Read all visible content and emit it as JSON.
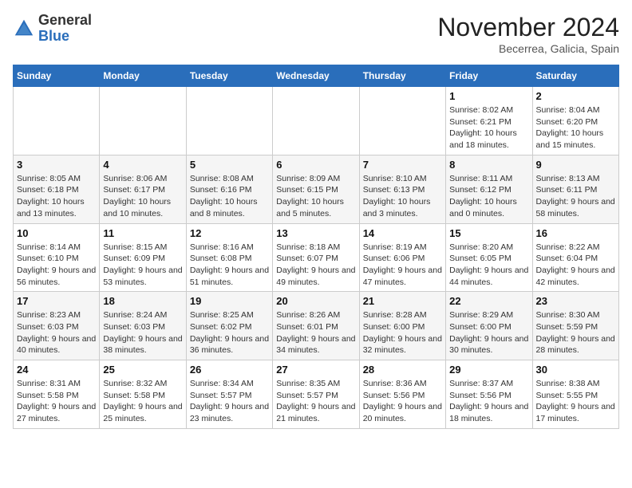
{
  "header": {
    "logo_line1": "General",
    "logo_line2": "Blue",
    "month": "November 2024",
    "location": "Becerrea, Galicia, Spain"
  },
  "weekdays": [
    "Sunday",
    "Monday",
    "Tuesday",
    "Wednesday",
    "Thursday",
    "Friday",
    "Saturday"
  ],
  "weeks": [
    [
      {
        "day": "",
        "info": ""
      },
      {
        "day": "",
        "info": ""
      },
      {
        "day": "",
        "info": ""
      },
      {
        "day": "",
        "info": ""
      },
      {
        "day": "",
        "info": ""
      },
      {
        "day": "1",
        "info": "Sunrise: 8:02 AM\nSunset: 6:21 PM\nDaylight: 10 hours and 18 minutes."
      },
      {
        "day": "2",
        "info": "Sunrise: 8:04 AM\nSunset: 6:20 PM\nDaylight: 10 hours and 15 minutes."
      }
    ],
    [
      {
        "day": "3",
        "info": "Sunrise: 8:05 AM\nSunset: 6:18 PM\nDaylight: 10 hours and 13 minutes."
      },
      {
        "day": "4",
        "info": "Sunrise: 8:06 AM\nSunset: 6:17 PM\nDaylight: 10 hours and 10 minutes."
      },
      {
        "day": "5",
        "info": "Sunrise: 8:08 AM\nSunset: 6:16 PM\nDaylight: 10 hours and 8 minutes."
      },
      {
        "day": "6",
        "info": "Sunrise: 8:09 AM\nSunset: 6:15 PM\nDaylight: 10 hours and 5 minutes."
      },
      {
        "day": "7",
        "info": "Sunrise: 8:10 AM\nSunset: 6:13 PM\nDaylight: 10 hours and 3 minutes."
      },
      {
        "day": "8",
        "info": "Sunrise: 8:11 AM\nSunset: 6:12 PM\nDaylight: 10 hours and 0 minutes."
      },
      {
        "day": "9",
        "info": "Sunrise: 8:13 AM\nSunset: 6:11 PM\nDaylight: 9 hours and 58 minutes."
      }
    ],
    [
      {
        "day": "10",
        "info": "Sunrise: 8:14 AM\nSunset: 6:10 PM\nDaylight: 9 hours and 56 minutes."
      },
      {
        "day": "11",
        "info": "Sunrise: 8:15 AM\nSunset: 6:09 PM\nDaylight: 9 hours and 53 minutes."
      },
      {
        "day": "12",
        "info": "Sunrise: 8:16 AM\nSunset: 6:08 PM\nDaylight: 9 hours and 51 minutes."
      },
      {
        "day": "13",
        "info": "Sunrise: 8:18 AM\nSunset: 6:07 PM\nDaylight: 9 hours and 49 minutes."
      },
      {
        "day": "14",
        "info": "Sunrise: 8:19 AM\nSunset: 6:06 PM\nDaylight: 9 hours and 47 minutes."
      },
      {
        "day": "15",
        "info": "Sunrise: 8:20 AM\nSunset: 6:05 PM\nDaylight: 9 hours and 44 minutes."
      },
      {
        "day": "16",
        "info": "Sunrise: 8:22 AM\nSunset: 6:04 PM\nDaylight: 9 hours and 42 minutes."
      }
    ],
    [
      {
        "day": "17",
        "info": "Sunrise: 8:23 AM\nSunset: 6:03 PM\nDaylight: 9 hours and 40 minutes."
      },
      {
        "day": "18",
        "info": "Sunrise: 8:24 AM\nSunset: 6:03 PM\nDaylight: 9 hours and 38 minutes."
      },
      {
        "day": "19",
        "info": "Sunrise: 8:25 AM\nSunset: 6:02 PM\nDaylight: 9 hours and 36 minutes."
      },
      {
        "day": "20",
        "info": "Sunrise: 8:26 AM\nSunset: 6:01 PM\nDaylight: 9 hours and 34 minutes."
      },
      {
        "day": "21",
        "info": "Sunrise: 8:28 AM\nSunset: 6:00 PM\nDaylight: 9 hours and 32 minutes."
      },
      {
        "day": "22",
        "info": "Sunrise: 8:29 AM\nSunset: 6:00 PM\nDaylight: 9 hours and 30 minutes."
      },
      {
        "day": "23",
        "info": "Sunrise: 8:30 AM\nSunset: 5:59 PM\nDaylight: 9 hours and 28 minutes."
      }
    ],
    [
      {
        "day": "24",
        "info": "Sunrise: 8:31 AM\nSunset: 5:58 PM\nDaylight: 9 hours and 27 minutes."
      },
      {
        "day": "25",
        "info": "Sunrise: 8:32 AM\nSunset: 5:58 PM\nDaylight: 9 hours and 25 minutes."
      },
      {
        "day": "26",
        "info": "Sunrise: 8:34 AM\nSunset: 5:57 PM\nDaylight: 9 hours and 23 minutes."
      },
      {
        "day": "27",
        "info": "Sunrise: 8:35 AM\nSunset: 5:57 PM\nDaylight: 9 hours and 21 minutes."
      },
      {
        "day": "28",
        "info": "Sunrise: 8:36 AM\nSunset: 5:56 PM\nDaylight: 9 hours and 20 minutes."
      },
      {
        "day": "29",
        "info": "Sunrise: 8:37 AM\nSunset: 5:56 PM\nDaylight: 9 hours and 18 minutes."
      },
      {
        "day": "30",
        "info": "Sunrise: 8:38 AM\nSunset: 5:55 PM\nDaylight: 9 hours and 17 minutes."
      }
    ]
  ]
}
